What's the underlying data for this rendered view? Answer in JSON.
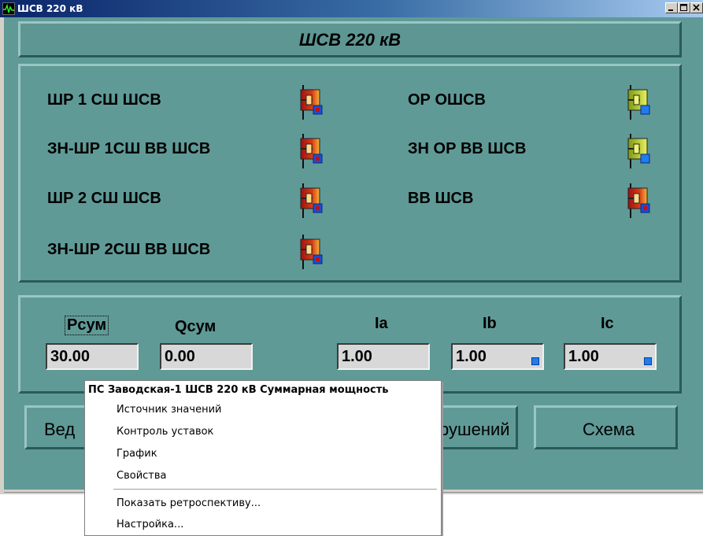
{
  "window": {
    "title": "ШСВ 220 кВ",
    "icon": "oscilloscope-app-icon",
    "controls": [
      "minimize-icon",
      "maximize-icon",
      "close-icon"
    ]
  },
  "header": {
    "title": "ШСВ 220 кВ"
  },
  "switches": {
    "left": [
      {
        "label": "ШР 1 СШ ШСВ",
        "state": "off",
        "color": "#d83b14"
      },
      {
        "label": "ЗН-ШР 1СШ ВВ ШСВ",
        "state": "off",
        "color": "#d83b14"
      },
      {
        "label": "ШР 2 СШ ШСВ",
        "state": "off",
        "color": "#d83b14"
      },
      {
        "label": "ЗН-ШР 2СШ ВВ ШСВ",
        "state": "off",
        "color": "#d83b14"
      }
    ],
    "right": [
      {
        "label": "ОР ОШСВ",
        "state": "on",
        "color": "#a8c81a"
      },
      {
        "label": "ЗН ОР ВВ ШСВ",
        "state": "on",
        "color": "#a8c81a"
      },
      {
        "label": "ВВ ШСВ",
        "state": "off",
        "color": "#d83b14"
      }
    ]
  },
  "measurements": [
    {
      "label": "Pсум",
      "value": "30.00"
    },
    {
      "label": "Qсум",
      "value": "0.00"
    },
    {
      "label": "Ia",
      "value": "1.00"
    },
    {
      "label": "Ib",
      "value": "1.00"
    },
    {
      "label": "Ic",
      "value": "1.00"
    }
  ],
  "bottom_buttons": {
    "log": "Ведомость нарушений",
    "log_visible_left": "Вед",
    "log_visible_right": "рушений",
    "scheme": "Схема"
  },
  "context_menu": {
    "header": "ПС Заводская-1  ШСВ 220 кВ Суммарная мощность",
    "items": [
      "Источник значений",
      "Контроль уставок",
      "График",
      "Свойства"
    ],
    "items2": [
      "Показать ретроспективу...",
      "Настройка..."
    ]
  },
  "colors": {
    "panel": "#5f9a97",
    "off_state": "#d83b14",
    "on_state": "#a8c81a",
    "marker": "#1e7cf0"
  }
}
